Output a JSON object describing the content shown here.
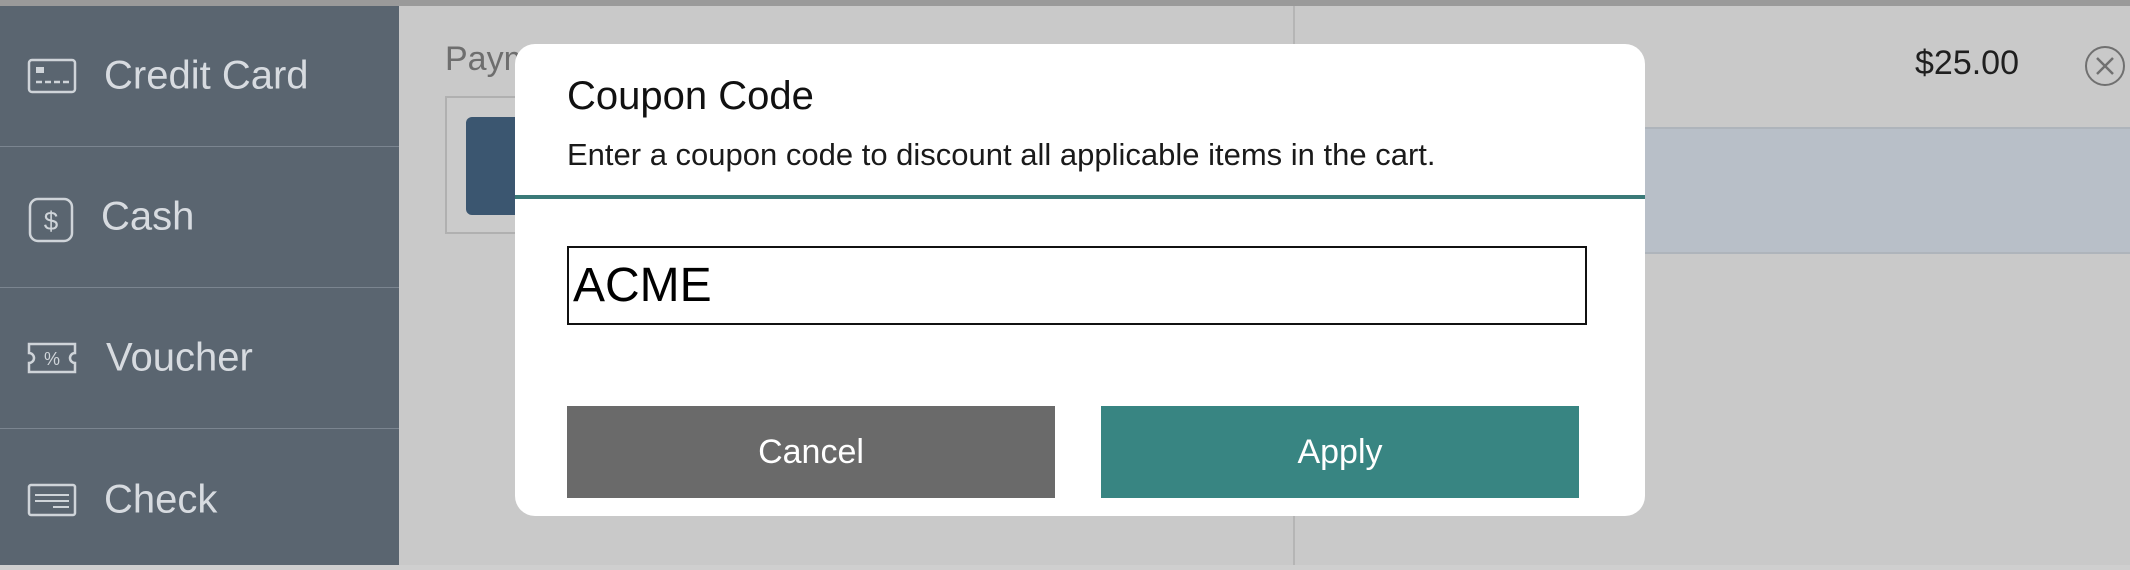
{
  "sidebar": {
    "items": [
      {
        "label": "Credit Card",
        "icon": "credit-card-icon"
      },
      {
        "label": "Cash",
        "icon": "dollar-icon"
      },
      {
        "label": "Voucher",
        "icon": "voucher-percent-icon"
      },
      {
        "label": "Check",
        "icon": "check-icon"
      }
    ]
  },
  "main": {
    "payment_title": "Paym",
    "line_item_price": "$25.00",
    "remove_icon": "close-circle-icon"
  },
  "modal": {
    "title": "Coupon Code",
    "description": "Enter a coupon code to discount all applicable items in the cart.",
    "input_value": "ACME",
    "cancel_label": "Cancel",
    "apply_label": "Apply"
  },
  "colors": {
    "sidebar_bg": "#5a6570",
    "accent_teal": "#388582",
    "cancel_gray": "#6a6a6a"
  }
}
